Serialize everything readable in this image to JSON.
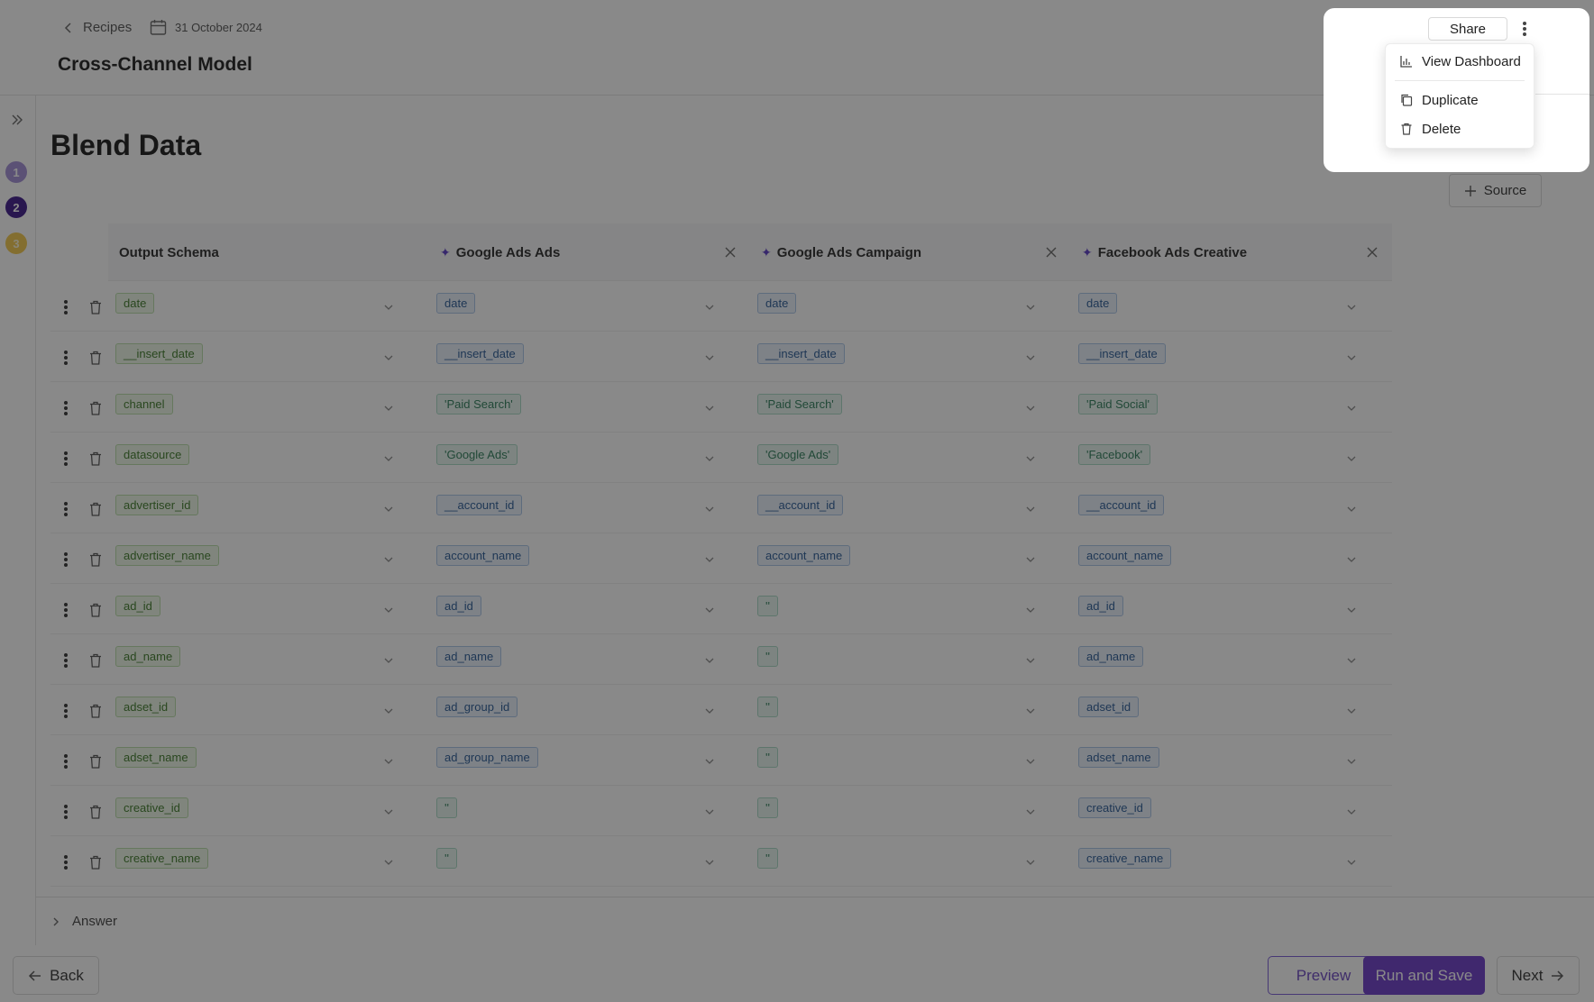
{
  "header": {
    "breadcrumb": "Recipes",
    "date": "31 October 2024",
    "title": "Cross-Channel Model"
  },
  "steps": [
    "1",
    "2",
    "3"
  ],
  "section_title": "Blend Data",
  "source_button": "Source",
  "columns": [
    {
      "label": "Output Schema",
      "ai": false,
      "closable": false
    },
    {
      "label": "Google Ads Ads",
      "ai": true,
      "closable": true
    },
    {
      "label": "Google Ads Campaign",
      "ai": true,
      "closable": true
    },
    {
      "label": "Facebook Ads Creative",
      "ai": true,
      "closable": true
    }
  ],
  "rows": [
    [
      {
        "t": "date",
        "c": "green"
      },
      {
        "t": "date",
        "c": "blue"
      },
      {
        "t": "date",
        "c": "blue"
      },
      {
        "t": "date",
        "c": "blue"
      }
    ],
    [
      {
        "t": "__insert_date",
        "c": "green"
      },
      {
        "t": "__insert_date",
        "c": "blue"
      },
      {
        "t": "__insert_date",
        "c": "blue"
      },
      {
        "t": "__insert_date",
        "c": "blue"
      }
    ],
    [
      {
        "t": "channel",
        "c": "green"
      },
      {
        "t": "'Paid Search'",
        "c": "teal"
      },
      {
        "t": "'Paid Search'",
        "c": "teal"
      },
      {
        "t": "'Paid Social'",
        "c": "teal"
      }
    ],
    [
      {
        "t": "datasource",
        "c": "green"
      },
      {
        "t": "'Google Ads'",
        "c": "teal"
      },
      {
        "t": "'Google Ads'",
        "c": "teal"
      },
      {
        "t": "'Facebook'",
        "c": "teal"
      }
    ],
    [
      {
        "t": "advertiser_id",
        "c": "green"
      },
      {
        "t": "__account_id",
        "c": "blue"
      },
      {
        "t": "__account_id",
        "c": "blue"
      },
      {
        "t": "__account_id",
        "c": "blue"
      }
    ],
    [
      {
        "t": "advertiser_name",
        "c": "green"
      },
      {
        "t": "account_name",
        "c": "blue"
      },
      {
        "t": "account_name",
        "c": "blue"
      },
      {
        "t": "account_name",
        "c": "blue"
      }
    ],
    [
      {
        "t": "ad_id",
        "c": "green"
      },
      {
        "t": "ad_id",
        "c": "blue"
      },
      {
        "t": "''",
        "c": "teal"
      },
      {
        "t": "ad_id",
        "c": "blue"
      }
    ],
    [
      {
        "t": "ad_name",
        "c": "green"
      },
      {
        "t": "ad_name",
        "c": "blue"
      },
      {
        "t": "''",
        "c": "teal"
      },
      {
        "t": "ad_name",
        "c": "blue"
      }
    ],
    [
      {
        "t": "adset_id",
        "c": "green"
      },
      {
        "t": "ad_group_id",
        "c": "blue"
      },
      {
        "t": "''",
        "c": "teal"
      },
      {
        "t": "adset_id",
        "c": "blue"
      }
    ],
    [
      {
        "t": "adset_name",
        "c": "green"
      },
      {
        "t": "ad_group_name",
        "c": "blue"
      },
      {
        "t": "''",
        "c": "teal"
      },
      {
        "t": "adset_name",
        "c": "blue"
      }
    ],
    [
      {
        "t": "creative_id",
        "c": "green"
      },
      {
        "t": "''",
        "c": "teal"
      },
      {
        "t": "''",
        "c": "teal"
      },
      {
        "t": "creative_id",
        "c": "blue"
      }
    ],
    [
      {
        "t": "creative_name",
        "c": "green"
      },
      {
        "t": "''",
        "c": "teal"
      },
      {
        "t": "''",
        "c": "teal"
      },
      {
        "t": "creative_name",
        "c": "blue"
      }
    ]
  ],
  "answer_label": "Answer",
  "footer": {
    "back": "Back",
    "preview": "Preview",
    "run": "Run and Save",
    "next": "Next"
  },
  "popup": {
    "share": "Share",
    "menu": [
      "View Dashboard",
      "Duplicate",
      "Delete"
    ]
  },
  "colors": {
    "accent": "#6c3cc8",
    "step_done": "#a28fd6",
    "step_current": "#3f1b8a",
    "step_pending": "#f2c94c"
  }
}
